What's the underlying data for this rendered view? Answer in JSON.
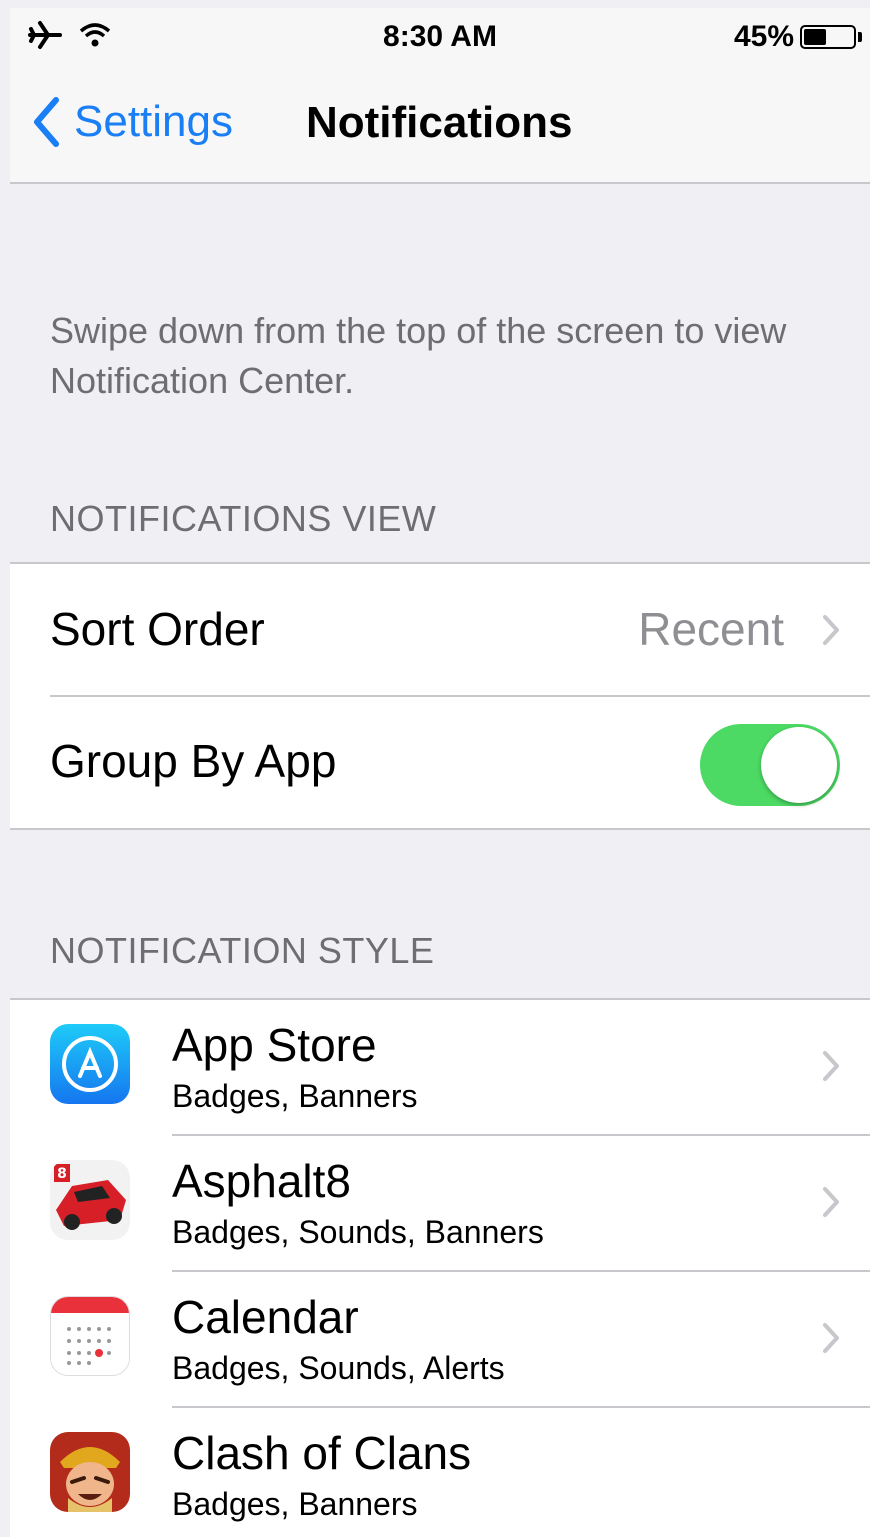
{
  "status_bar": {
    "time": "8:30 AM",
    "battery": "45%",
    "battery_level": 0.45,
    "icons": [
      "airplane-icon",
      "wifi-icon",
      "battery-icon"
    ]
  },
  "nav": {
    "back_label": "Settings",
    "title": "Notifications"
  },
  "description": "Swipe down from the top of the screen to view Notification Center.",
  "sections": {
    "view_header": "NOTIFICATIONS VIEW",
    "style_header": "NOTIFICATION STYLE"
  },
  "notifications_view": {
    "sort_order_label": "Sort Order",
    "sort_order_value": "Recent",
    "group_by_app_label": "Group By App",
    "group_by_app_enabled": true
  },
  "apps": [
    {
      "name": "App Store",
      "detail": "Badges, Banners",
      "icon": "app-store-icon"
    },
    {
      "name": "Asphalt8",
      "detail": "Badges, Sounds, Banners",
      "icon": "asphalt8-icon"
    },
    {
      "name": "Calendar",
      "detail": "Badges, Sounds, Alerts",
      "icon": "calendar-icon"
    },
    {
      "name": "Clash of Clans",
      "detail": "Badges, Banners",
      "icon": "clash-of-clans-icon"
    }
  ],
  "colors": {
    "accent": "#1a7ef5",
    "toggle_on": "#4cd964",
    "background": "#efeff4",
    "secondary_text": "#6d6d72"
  }
}
